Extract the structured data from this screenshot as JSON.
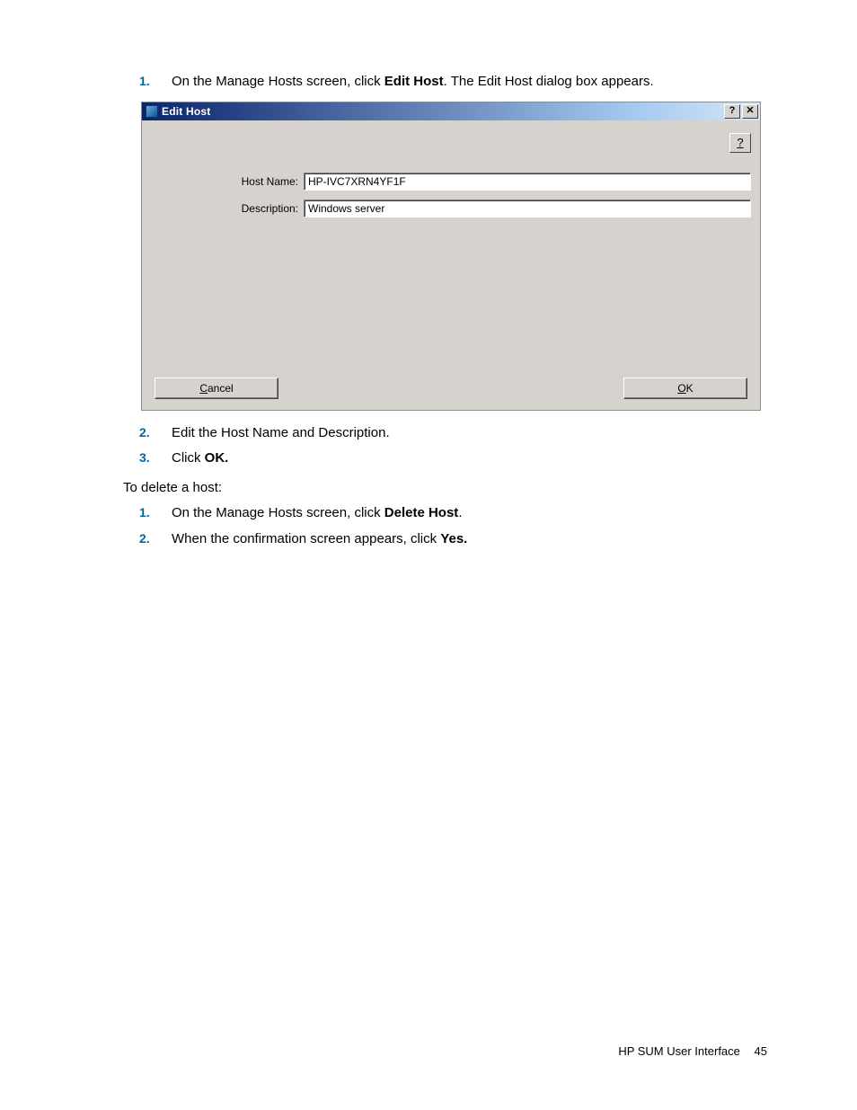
{
  "steps1": {
    "item1": {
      "num": "1.",
      "pre": "On the Manage Hosts screen, click ",
      "bold": "Edit Host",
      "post": ". The Edit Host dialog box appears."
    }
  },
  "dialog": {
    "title": "Edit Host",
    "help_btn": "?",
    "close_btn": "✕",
    "body_help": "?",
    "host_name_label": "Host Name:",
    "host_name_value": "HP-IVC7XRN4YF1F",
    "description_label": "Description:",
    "description_value": "Windows server",
    "cancel": "Cancel",
    "ok": "OK"
  },
  "steps2": {
    "item2": {
      "num": "2.",
      "text": "Edit the Host Name and Description."
    },
    "item3": {
      "num": "3.",
      "pre": "Click ",
      "bold": "OK."
    }
  },
  "para_delete": "To delete a host:",
  "steps3": {
    "item1": {
      "num": "1.",
      "pre": "On the Manage Hosts screen, click ",
      "bold": "Delete Host",
      "post": "."
    },
    "item2": {
      "num": "2.",
      "pre": "When the confirmation screen appears, click ",
      "bold": "Yes."
    }
  },
  "footer": {
    "label": "HP SUM User Interface",
    "page": "45"
  }
}
